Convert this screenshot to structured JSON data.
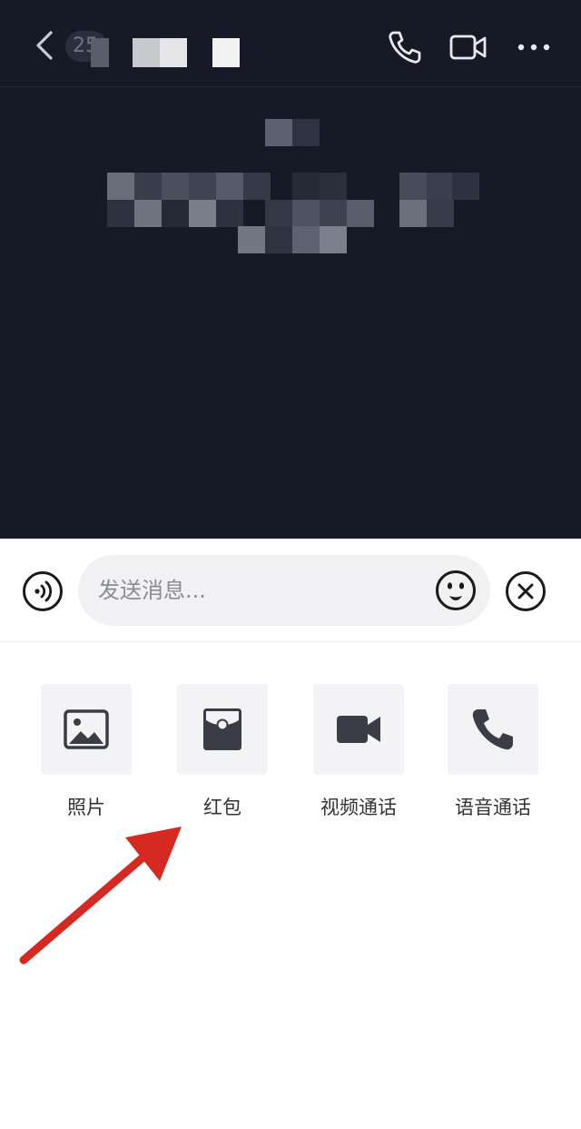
{
  "header": {
    "unread_count": "25",
    "icons": [
      "back-icon",
      "phone-icon",
      "video-camera-icon",
      "more-icon"
    ]
  },
  "input_bar": {
    "placeholder": "发送消息...",
    "icons": [
      "voice-icon",
      "emoji-icon",
      "close-icon"
    ]
  },
  "tools": [
    {
      "label": "照片",
      "icon": "photo-icon"
    },
    {
      "label": "红包",
      "icon": "red-envelope-icon"
    },
    {
      "label": "视频通话",
      "icon": "video-call-icon"
    },
    {
      "label": "语音通话",
      "icon": "voice-call-icon"
    }
  ],
  "colors": {
    "chat_bg": "#161a26",
    "icon_dark": "#3a3d45",
    "arrow": "#d42a22"
  }
}
